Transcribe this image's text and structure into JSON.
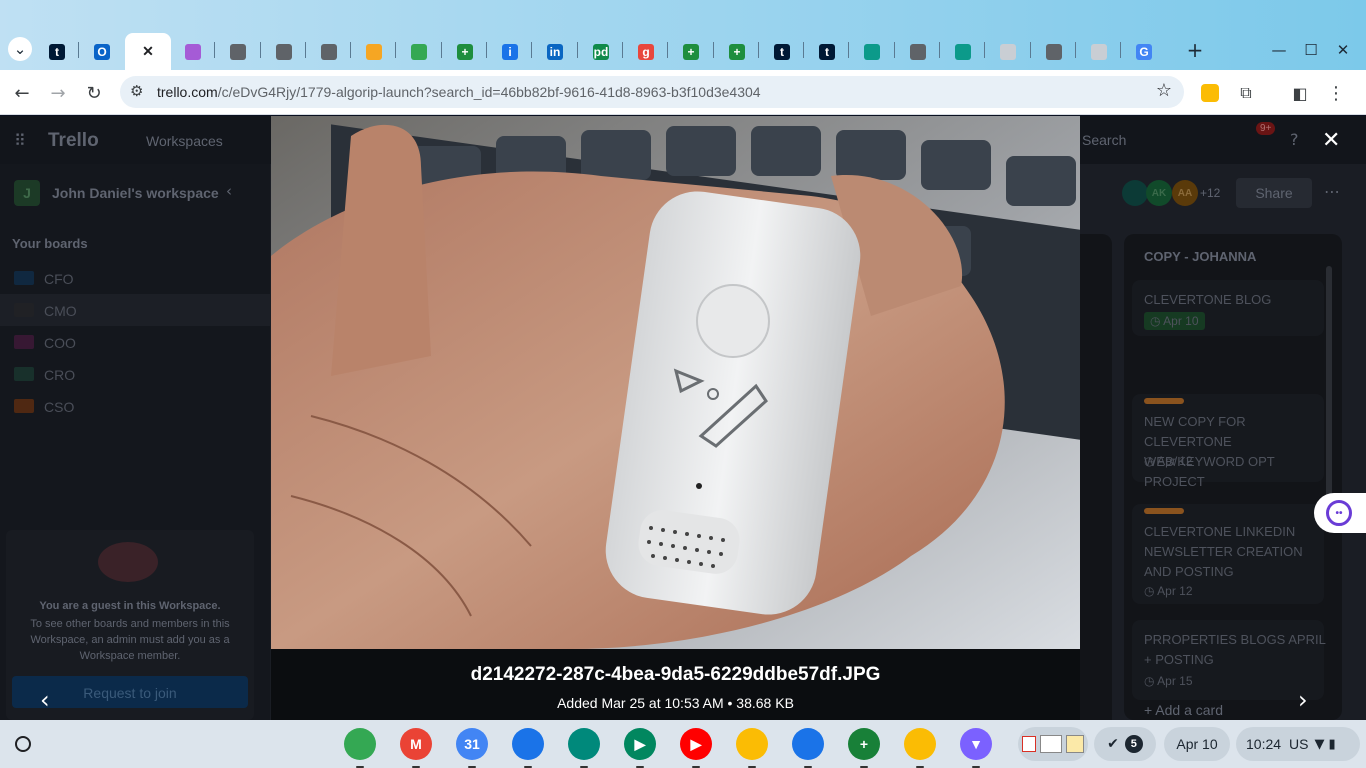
{
  "browser": {
    "tabs": [
      {
        "icon": "tumblr-icon",
        "letter": "t",
        "color": "#001935"
      },
      {
        "icon": "outlook-icon",
        "letter": "O",
        "color": "#0a64c8"
      },
      {
        "icon": "close-icon",
        "letter": "✕",
        "color": "#202124",
        "active": true
      },
      {
        "icon": "app-icon",
        "letter": "",
        "color": "#a55bd6"
      },
      {
        "icon": "globe-icon",
        "letter": "",
        "color": "#5f6368"
      },
      {
        "icon": "globe-icon",
        "letter": "",
        "color": "#5f6368"
      },
      {
        "icon": "globe-icon",
        "letter": "",
        "color": "#5f6368"
      },
      {
        "icon": "orange-circle-icon",
        "letter": "",
        "color": "#f6a623"
      },
      {
        "icon": "google-drive-icon",
        "letter": "",
        "color": "#34a853"
      },
      {
        "icon": "google-sheets-icon",
        "letter": "+",
        "color": "#1e8e3e"
      },
      {
        "icon": "info-icon",
        "letter": "i",
        "color": "#1a73e8"
      },
      {
        "icon": "linkedin-icon",
        "letter": "in",
        "color": "#0a66c2"
      },
      {
        "icon": "pd-icon",
        "letter": "pd",
        "color": "#0f8a4a"
      },
      {
        "icon": "g-icon",
        "letter": "g",
        "color": "#e8473d"
      },
      {
        "icon": "google-sheets-icon",
        "letter": "+",
        "color": "#1e8e3e"
      },
      {
        "icon": "google-sheets-icon",
        "letter": "+",
        "color": "#1e8e3e"
      },
      {
        "icon": "tumblr-icon",
        "letter": "t",
        "color": "#001935"
      },
      {
        "icon": "tumblr-icon",
        "letter": "t",
        "color": "#001935"
      },
      {
        "icon": "palm-icon",
        "letter": "",
        "color": "#0c9a8a"
      },
      {
        "icon": "globe-icon",
        "letter": "",
        "color": "#5f6368"
      },
      {
        "icon": "palm-icon",
        "letter": "",
        "color": "#0c9a8a"
      },
      {
        "icon": "doc-icon",
        "letter": "",
        "color": "#c9ced4"
      },
      {
        "icon": "globe-icon",
        "letter": "",
        "color": "#5f6368"
      },
      {
        "icon": "doc-icon",
        "letter": "",
        "color": "#c9ced4"
      },
      {
        "icon": "google-icon",
        "letter": "G",
        "color": "#4285f4"
      }
    ],
    "new_tab": "+",
    "url_host": "trello.com",
    "url_path": "/c/eDvG4Rjy/1779-algorip-launch?search_id=46bb82bf-9616-41d8-8963-b3f10d3e4304"
  },
  "trello": {
    "logo": "Trello",
    "workspaces": "Workspaces",
    "workspace_initial": "J",
    "workspace_name": "John Daniel's workspace",
    "your_boards": "Your boards",
    "boards": [
      {
        "name": "CFO",
        "color": "#0b3a63"
      },
      {
        "name": "CMO",
        "color": "#242424"
      },
      {
        "name": "COO",
        "color": "#5a1a4a"
      },
      {
        "name": "CRO",
        "color": "#1b4a3a"
      },
      {
        "name": "CSO",
        "color": "#8a3a08"
      }
    ],
    "guest_title": "You are a guest in this Workspace.",
    "guest_text": "To see other boards and members in this Workspace, an admin must add you as a Workspace member.",
    "request_button": "Request to join",
    "search_placeholder": "Search",
    "notification_count": "9+",
    "member_initials": [
      "AK",
      "AA"
    ],
    "member_more": "+12",
    "share": "Share",
    "list_title": "COPY - JOHANNA",
    "cards": [
      {
        "title": "CLEVERTONE BLOG POSTING",
        "date": "Apr 10",
        "label": ""
      },
      {
        "title": "NEW COPY FOR CLEVERTONE WEB/KEYWORD OPT PROJECT",
        "date": "Apr 12",
        "label": "#d97a1e"
      },
      {
        "title": "CLEVERTONE LINKEDIN NEWSLETTER CREATION AND POSTING",
        "date": "Apr 12",
        "label": "#d97a1e"
      },
      {
        "title": "PRROPERTIES BLOGS APRIL + POSTING",
        "date": "Apr 15",
        "label": ""
      }
    ],
    "add_card": "Add a card"
  },
  "viewer": {
    "filename": "d2142272-287c-4bea-9da5-6229ddbe57df.JPG",
    "meta": "Added Mar 25 at 10:53 AM • 38.68 KB"
  },
  "taskbar": {
    "apps": [
      {
        "icon": "chrome-icon",
        "color": "#34a853",
        "letter": ""
      },
      {
        "icon": "gmail-icon",
        "color": "#ea4335",
        "letter": "M"
      },
      {
        "icon": "google-calendar-icon",
        "color": "#4285f4",
        "letter": "31"
      },
      {
        "icon": "files-icon",
        "color": "#1a73e8",
        "letter": ""
      },
      {
        "icon": "google-meet-icon",
        "color": "#00897b",
        "letter": ""
      },
      {
        "icon": "play-store-icon",
        "color": "#01875f",
        "letter": "▶"
      },
      {
        "icon": "youtube-icon",
        "color": "#ff0000",
        "letter": "▶"
      },
      {
        "icon": "google-photos-icon",
        "color": "#fbbc04",
        "letter": ""
      },
      {
        "icon": "messages-icon",
        "color": "#1a73e8",
        "letter": ""
      },
      {
        "icon": "google-sheets-icon",
        "color": "#188038",
        "letter": "+"
      },
      {
        "icon": "google-keep-icon",
        "color": "#fbbc04",
        "letter": ""
      },
      {
        "icon": "vpn-icon",
        "color": "#7b61ff",
        "letter": "▼"
      }
    ],
    "notification_count": "5",
    "date": "Apr 10",
    "time": "10:24",
    "locale": "US"
  }
}
